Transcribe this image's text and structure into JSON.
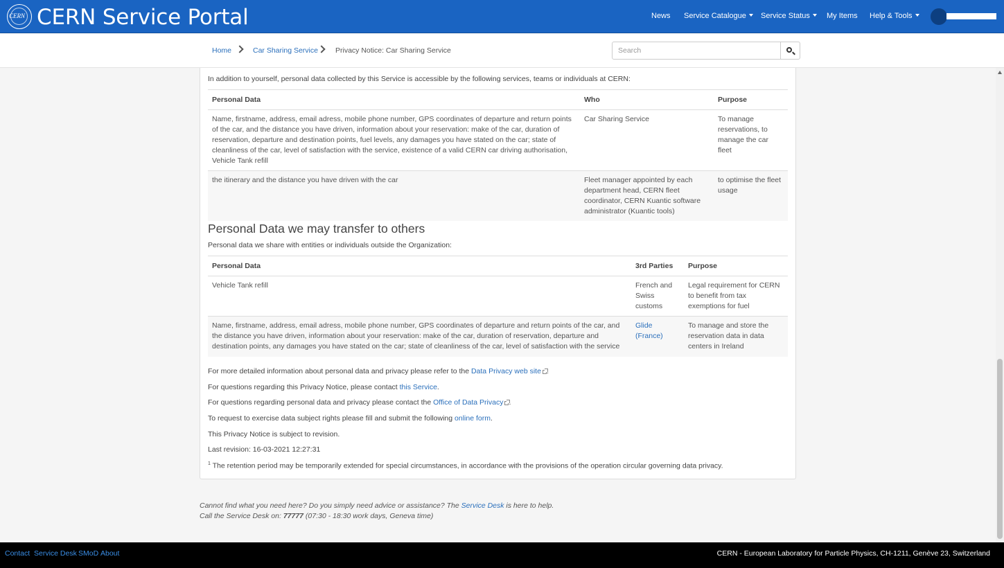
{
  "header": {
    "logo_text": "CERN",
    "title": "CERN Service Portal",
    "nav": {
      "news": "News",
      "catalogue": "Service Catalogue",
      "status": "Service Status",
      "my_items": "My Items",
      "help": "Help & Tools"
    }
  },
  "breadcrumb": {
    "home": "Home",
    "service": "Car Sharing Service",
    "current": "Privacy Notice: Car Sharing Service"
  },
  "search": {
    "placeholder": "Search"
  },
  "intro": "In addition to yourself, personal data collected by this Service is accessible by the following services, teams or individuals at CERN:",
  "access_table": {
    "headers": [
      "Personal Data",
      "Who",
      "Purpose"
    ],
    "rows": [
      {
        "data": "Name, firstname, address, email adress, mobile phone number, GPS coordinates of departure and return points of the car, and the distance you have driven, information about your reservation: make of the car, duration of reservation, departure and destination points, fuel levels, any damages you have stated on the car; state of cleanliness of the car, level of satisfaction with the service, existence of a valid CERN car driving authorisation, Vehicle Tank refill",
        "who": "Car Sharing Service",
        "purpose": "To manage reservations, to manage the car fleet"
      },
      {
        "data": "the itinerary and the distance you have driven with the car",
        "who": "Fleet manager appointed by each department head, CERN fleet coordinator, CERN Kuantic software administrator (Kuantic tools)",
        "purpose": "to optimise the fleet usage"
      }
    ]
  },
  "transfer": {
    "heading": "Personal Data we may transfer to others",
    "intro": "Personal data we share with entities or individuals outside the Organization:",
    "headers": [
      "Personal Data",
      "3rd Parties",
      "Purpose"
    ],
    "rows": [
      {
        "data": "Vehicle Tank refill",
        "party": "French and Swiss customs",
        "purpose": "Legal requirement for CERN to benefit from tax exemptions for fuel"
      },
      {
        "data": "Name, firstname, address, email adress, mobile phone number, GPS coordinates of departure and return points of the car, and the distance you have driven, information about your reservation: make of the car, duration of reservation, departure and destination points, any damages you have stated on the car; state of cleanliness of the car, level of satisfaction with the service",
        "party": "Glide (France)",
        "purpose": "To manage and store the reservation data in data centers in Ireland"
      }
    ]
  },
  "info": {
    "l1_pre": "For more detailed information about personal data and privacy please refer to the ",
    "l1_link": "Data Privacy web site",
    "l2_pre": "For questions regarding this Privacy Notice, please contact ",
    "l2_link": "this Service",
    "l3_pre": "For questions regarding personal data and privacy please contact the ",
    "l3_link": "Office of Data Privacy",
    "l4_pre": "To request to exercise data subject rights please fill and submit the following ",
    "l4_link": "online form",
    "l5": "This Privacy Notice is subject to revision.",
    "l6": "Last revision: 16-03-2021 12:27:31",
    "footnote_mark": "1",
    "footnote": " The retention period may be temporarily extended for special circumstances, in accordance with the provisions of the operation circular governing data privacy."
  },
  "help_box": {
    "line1_pre": "Cannot find what you need here? Do you simply need advice or assistance? The ",
    "line1_link": "Service Desk",
    "line1_post": " is here to help.",
    "line2_pre": "Call the Service Desk on: ",
    "line2_number": "77777",
    "line2_post": " (07:30 - 18:30 work days, Geneva time)"
  },
  "footer": {
    "contact": "Contact",
    "service_desk": "Service Desk",
    "smod": "SMoD",
    "about": "About",
    "address": "CERN - European Laboratory for Particle Physics, CH-1211, Genève 23, Switzerland"
  }
}
